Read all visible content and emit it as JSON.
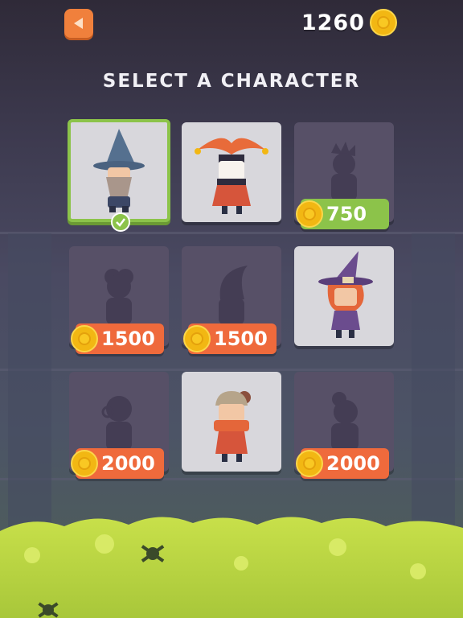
{
  "header": {
    "back_label": "back",
    "coins": "1260"
  },
  "title": "SELECT A CHARACTER",
  "characters": [
    {
      "name": "Wizard",
      "price": "",
      "locked": false,
      "selected": true
    },
    {
      "name": "Jester",
      "price": "",
      "locked": false,
      "selected": false
    },
    {
      "name": "Spiky Knight",
      "price": "750",
      "locked": true,
      "selected": false
    },
    {
      "name": "Curly",
      "price": "1500",
      "locked": true,
      "selected": false
    },
    {
      "name": "Hood",
      "price": "1500",
      "locked": true,
      "selected": false
    },
    {
      "name": "Witch",
      "price": "",
      "locked": false,
      "selected": false
    },
    {
      "name": "Monocle",
      "price": "2000",
      "locked": true,
      "selected": false
    },
    {
      "name": "Scarf Kid",
      "price": "",
      "locked": false,
      "selected": false
    },
    {
      "name": "Bun",
      "price": "2000",
      "locked": true,
      "selected": false
    }
  ],
  "colors": {
    "accent_orange": "#ef6a3c",
    "accent_green": "#8cc34a",
    "coin": "#f2b713",
    "fog": "#c8e04a"
  }
}
